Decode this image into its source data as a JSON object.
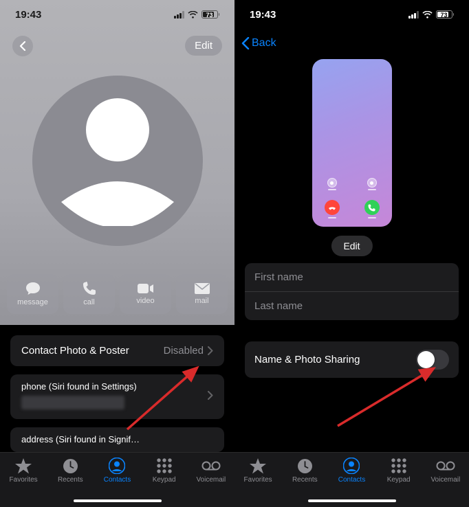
{
  "status": {
    "time": "19:43",
    "battery_pct": "73",
    "signal_bars": 3
  },
  "left": {
    "edit_label": "Edit",
    "actions": {
      "message": "message",
      "call": "call",
      "video": "video",
      "mail": "mail"
    },
    "contact_poster": {
      "title": "Contact Photo & Poster",
      "value": "Disabled"
    },
    "phone_row": {
      "title": "phone (Siri found in Settings)"
    },
    "address_row": {
      "title": "address (Siri found in Signif…"
    }
  },
  "right": {
    "back_label": "Back",
    "edit_label": "Edit",
    "first_name_placeholder": "First name",
    "last_name_placeholder": "Last name",
    "sharing": {
      "title": "Name & Photo Sharing",
      "enabled": false
    }
  },
  "tabs": {
    "favorites": "Favorites",
    "recents": "Recents",
    "contacts": "Contacts",
    "keypad": "Keypad",
    "voicemail": "Voicemail",
    "active": "contacts"
  }
}
